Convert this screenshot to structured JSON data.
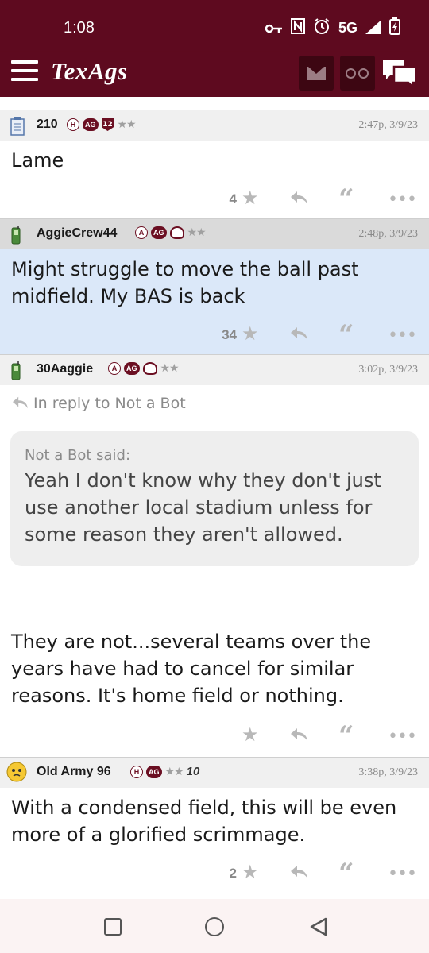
{
  "status_bar": {
    "time": "1:08",
    "network": "5G",
    "icons": [
      "key-icon",
      "nfc-icon",
      "alarm-icon",
      "signal-icon",
      "battery-charging-icon"
    ]
  },
  "app_bar": {
    "logo": "TexAgs",
    "icons": [
      "menu-icon",
      "mail-icon",
      "binoculars-icon",
      "chat-icon"
    ]
  },
  "colors": {
    "brand": "#5e0a1f",
    "highlight": "#dbe8f9"
  },
  "posts": [
    {
      "username": "210",
      "badges": [
        "H",
        "AG",
        "12"
      ],
      "stars": "★★",
      "timestamp": "2:47p, 3/9/23",
      "body": "Lame",
      "star_count": "4"
    },
    {
      "username": "AggieCrew44",
      "badges": [
        "A",
        "AG"
      ],
      "stars": "★★",
      "timestamp": "2:48p, 3/9/23",
      "body": "Might struggle to move the ball past midfield. My BAS is back",
      "star_count": "34",
      "highlighted": true
    },
    {
      "username": "30Aaggie",
      "badges": [
        "A",
        "AG"
      ],
      "stars": "★★",
      "timestamp": "3:02p, 3/9/23",
      "reply_to": "In reply to Not a Bot",
      "quote_label": "Not a Bot said:",
      "quote_text": "Yeah I don't know why they don't just use another local stadium unless for some reason they aren't allowed.",
      "body": "They are not...several teams over the years have had to cancel for similar reasons. It's home field or nothing.",
      "star_count": ""
    },
    {
      "username": "Old Army 96",
      "badges": [
        "H",
        "AG"
      ],
      "stars": "★★",
      "extra_badge": "10",
      "timestamp": "3:38p, 3/9/23",
      "body": "With a condensed field, this will be even more of a glorified scrimmage.",
      "star_count": "2"
    }
  ],
  "nav_bar": {
    "icons": [
      "recents-icon",
      "home-icon",
      "back-icon"
    ]
  }
}
